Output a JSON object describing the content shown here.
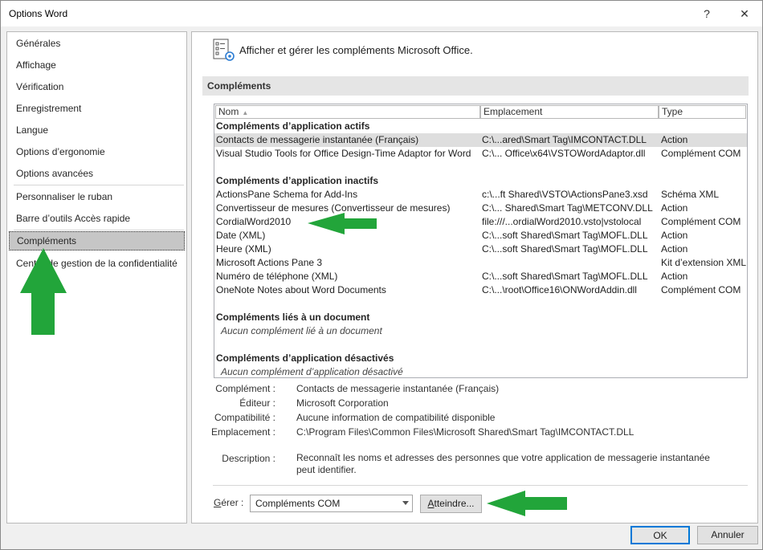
{
  "window": {
    "title": "Options Word",
    "help_glyph": "?",
    "close_glyph": "✕"
  },
  "nav": {
    "items": [
      {
        "label": "Générales"
      },
      {
        "label": "Affichage"
      },
      {
        "label": "Vérification"
      },
      {
        "label": "Enregistrement"
      },
      {
        "label": "Langue"
      },
      {
        "label": "Options d’ergonomie"
      },
      {
        "label": "Options avancées"
      },
      {
        "label": "Personnaliser le ruban"
      },
      {
        "label": "Barre d’outils Accès rapide"
      },
      {
        "label": "Compléments",
        "selected": true
      },
      {
        "label": "Centre de gestion de la confidentialité"
      }
    ]
  },
  "main": {
    "heading": "Afficher et gérer les compléments Microsoft Office.",
    "section_title": "Compléments",
    "columns": [
      "Nom",
      "Emplacement",
      "Type"
    ],
    "sort_glyph": "▲",
    "groups": {
      "active": {
        "title": "Compléments d’application actifs",
        "rows": [
          {
            "name": "Contacts de messagerie instantanée (Français)",
            "location": "C:\\...ared\\Smart Tag\\IMCONTACT.DLL",
            "type": "Action"
          },
          {
            "name": "Visual Studio Tools for Office Design-Time Adaptor for Word",
            "location": "C:\\... Office\\x64\\VSTOWordAdaptor.dll",
            "type": "Complément COM"
          }
        ]
      },
      "inactive": {
        "title": "Compléments d’application inactifs",
        "rows": [
          {
            "name": "ActionsPane Schema for Add-Ins",
            "location": "c:\\...ft Shared\\VSTO\\ActionsPane3.xsd",
            "type": "Schéma XML"
          },
          {
            "name": "Convertisseur de mesures (Convertisseur de mesures)",
            "location": "C:\\... Shared\\Smart Tag\\METCONV.DLL",
            "type": "Action"
          },
          {
            "name": "CordialWord2010",
            "location": "file:///...ordialWord2010.vsto|vstolocal",
            "type": "Complément COM"
          },
          {
            "name": "Date (XML)",
            "location": "C:\\...soft Shared\\Smart Tag\\MOFL.DLL",
            "type": "Action"
          },
          {
            "name": "Heure (XML)",
            "location": "C:\\...soft Shared\\Smart Tag\\MOFL.DLL",
            "type": "Action"
          },
          {
            "name": "Microsoft Actions Pane 3",
            "location": "",
            "type": "Kit d’extension XML"
          },
          {
            "name": "Numéro de téléphone (XML)",
            "location": "C:\\...soft Shared\\Smart Tag\\MOFL.DLL",
            "type": "Action"
          },
          {
            "name": "OneNote Notes about Word Documents",
            "location": "C:\\...\\root\\Office16\\ONWordAddin.dll",
            "type": "Complément COM"
          }
        ]
      },
      "document": {
        "title": "Compléments liés à un document",
        "empty": "Aucun complément lié à un document"
      },
      "disabled": {
        "title": "Compléments d’application désactivés",
        "empty": "Aucun complément d’application désactivé"
      }
    },
    "details": {
      "addin_label": "Complément :",
      "addin_value": "Contacts de messagerie instantanée (Français)",
      "publisher_label": "Éditeur :",
      "publisher_value": "Microsoft Corporation",
      "compat_label": "Compatibilité :",
      "compat_value": "Aucune information de compatibilité disponible",
      "location_label": "Emplacement :",
      "location_value": "C:\\Program Files\\Common Files\\Microsoft Shared\\Smart Tag\\IMCONTACT.DLL",
      "desc_label": "Description :",
      "desc_value": "Reconnaît les noms et adresses des personnes que votre application de messagerie instantanée peut identifier."
    },
    "manage": {
      "label_prefix": "G",
      "label_rest": "érer :",
      "selected": "Compléments COM",
      "go_button_u": "A",
      "go_button_rest": "tteindre..."
    }
  },
  "footer": {
    "ok": "OK",
    "cancel": "Annuler"
  },
  "annotations": {
    "arrow_color": "#22a53a"
  }
}
